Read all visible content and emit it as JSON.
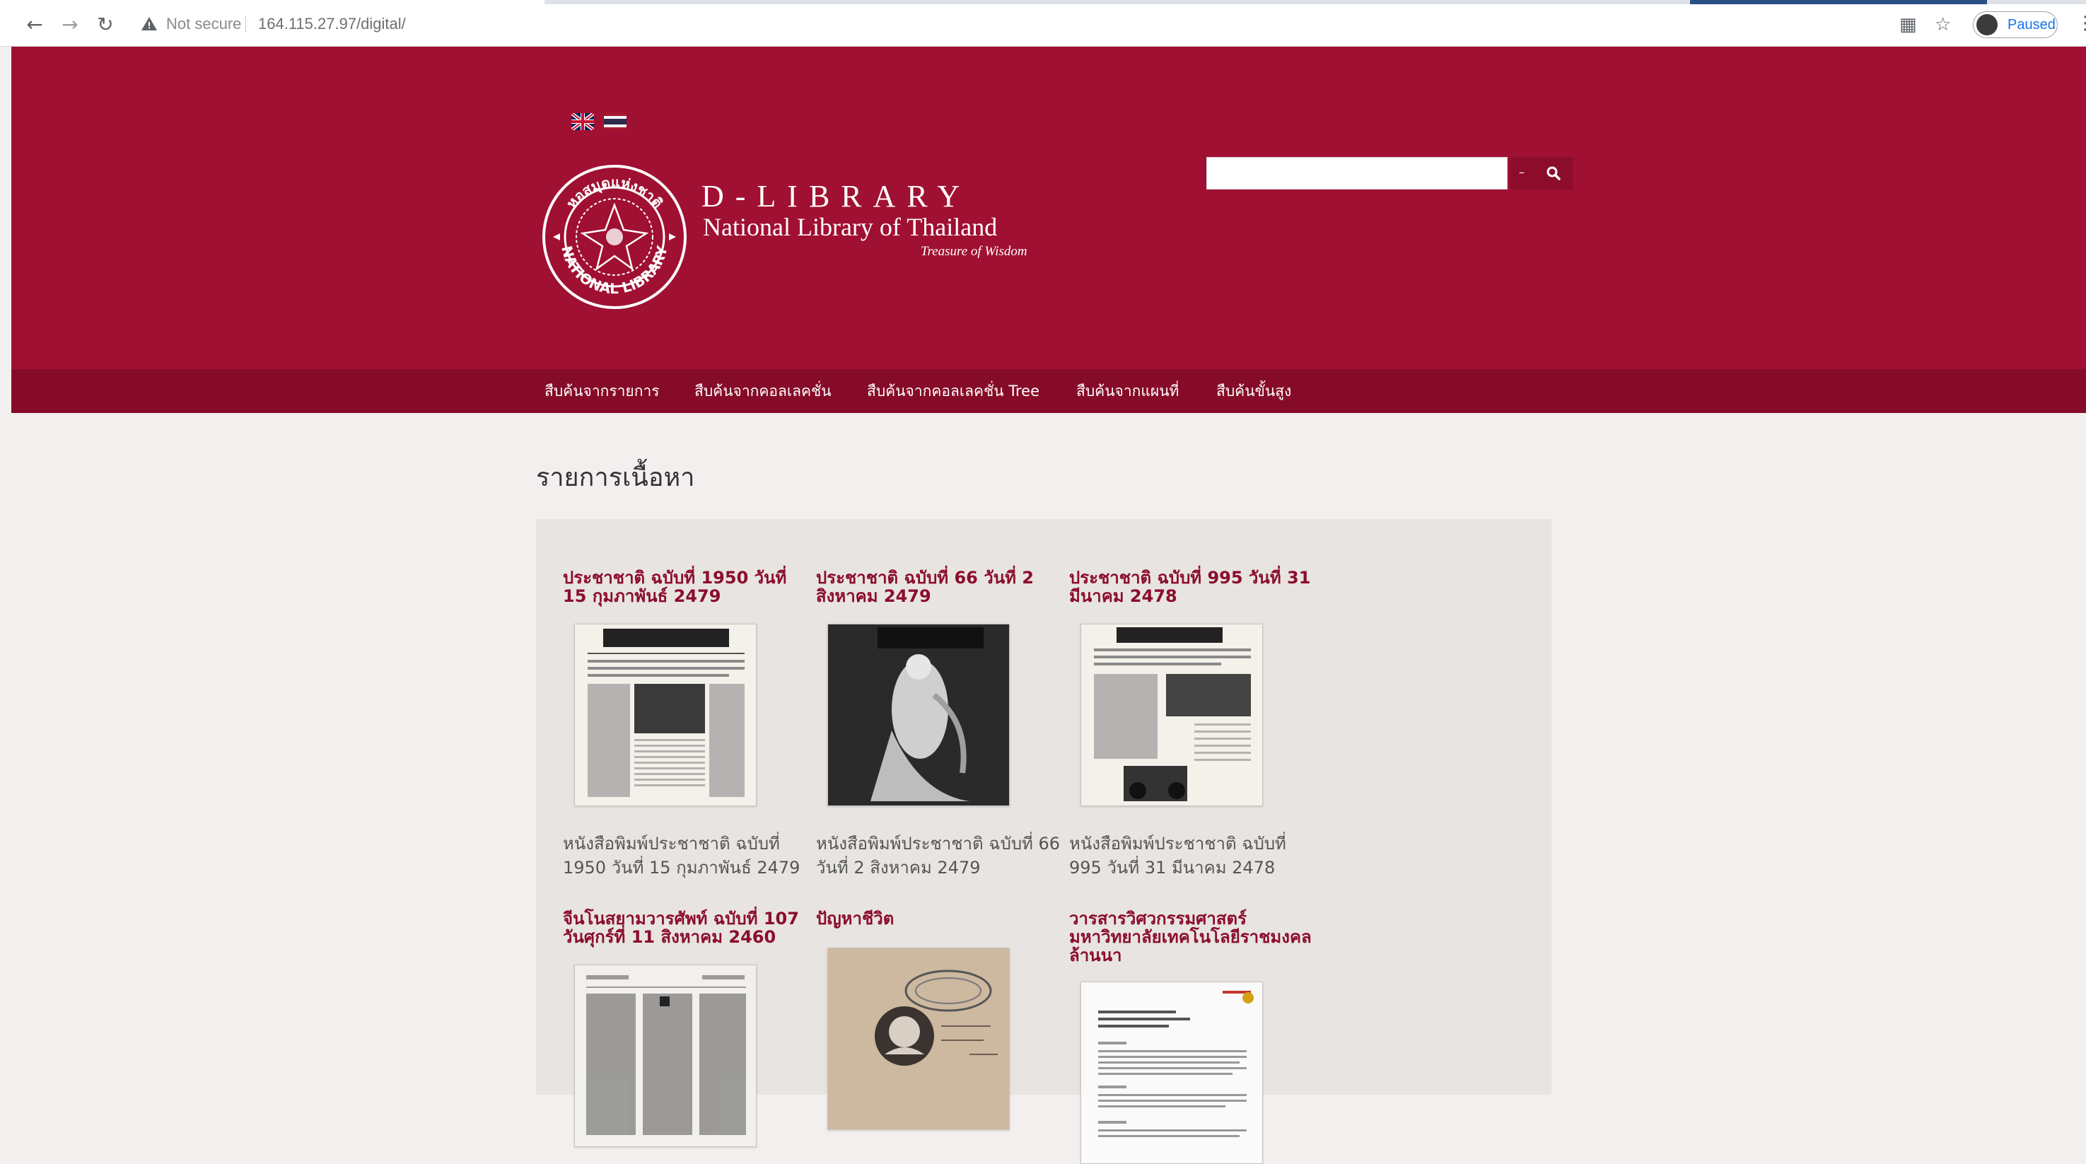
{
  "browser": {
    "security_label": "Not secure",
    "url": "164.115.27.97/digital/",
    "profile_label": "Paused",
    "icons": [
      "back-arrow-icon",
      "forward-arrow-icon",
      "reload-icon",
      "warning-icon",
      "translate-icon",
      "star-icon",
      "menu-dots-icon"
    ]
  },
  "header": {
    "languages": [
      "English",
      "Thai"
    ],
    "brand_title": "D-LIBRARY",
    "brand_subtitle": "National Library of Thailand",
    "brand_tagline": "Treasure of Wisdom",
    "seal_text": [
      "หอสมุดแห่งชาติ",
      "NATIONAL LIBRARY"
    ],
    "search_value": "",
    "search_dropdown": "–",
    "colors": {
      "header_bg": "#a01032",
      "menu_bg": "#860b28",
      "accent": "#8b0d2c"
    }
  },
  "menu": {
    "items": [
      "สืบค้นจากรายการ",
      "สืบค้นจากคอลเลคชั่น",
      "สืบค้นจากคอลเลคชั่น Tree",
      "สืบค้นจากแผนที่",
      "สืบค้นขั้นสูง"
    ]
  },
  "main": {
    "title": "รายการเนื้อหา",
    "items": [
      {
        "title": "ประชาชาติ ฉบับที่ 1950 วันที่ 15 กุมภาพันธ์ 2479",
        "description": "หนังสือพิมพ์ประชาชาติ ฉบับที่ 1950 วันที่ 15 กุมภาพันธ์ 2479"
      },
      {
        "title": "ประชาชาติ ฉบับที่ 66 วันที่ 2 สิงหาคม 2479",
        "description": "หนังสือพิมพ์ประชาชาติ ฉบับที่ 66 วันที่ 2 สิงหาคม 2479"
      },
      {
        "title": "ประชาชาติ ฉบับที่ 995 วันที่ 31 มีนาคม 2478",
        "description": "หนังสือพิมพ์ประชาชาติ ฉบับที่ 995 วันที่ 31 มีนาคม 2478"
      },
      {
        "title": "จีนโนสยามวารศัพท์ ฉบับที่ 107 วันศุกร์ที่ 11 สิงหาคม 2460",
        "description": ""
      },
      {
        "title": "ปัญหาชีวิต",
        "description": ""
      },
      {
        "title": "วารสารวิศวกรรมศาสตร์ มหาวิทยาลัยเทคโนโลยีราชมงคลล้านนา",
        "description": ""
      }
    ]
  }
}
